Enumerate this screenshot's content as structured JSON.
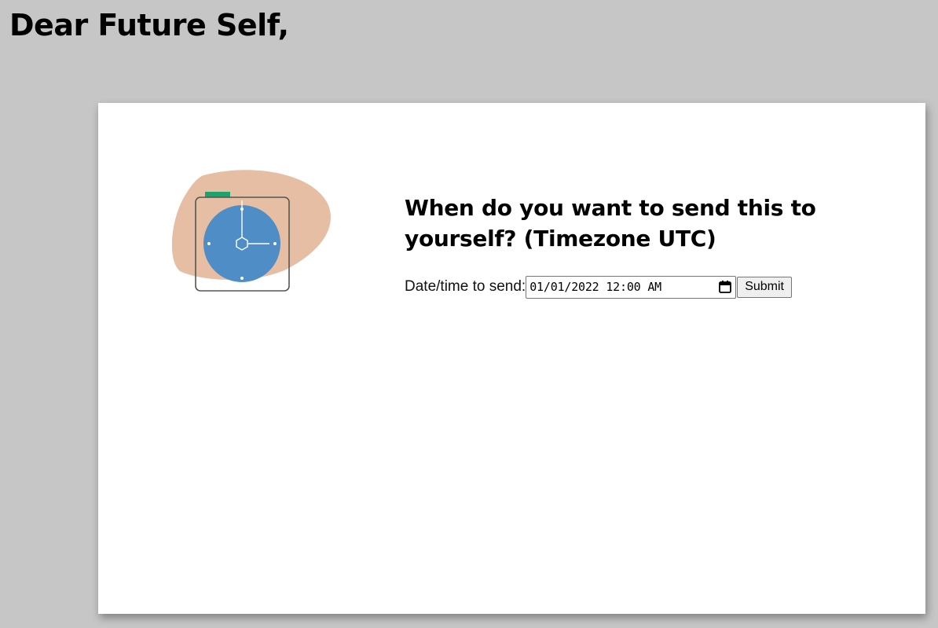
{
  "page": {
    "heading": "Dear Future Self,"
  },
  "card": {
    "question": "When do you want to send this to yourself? (Timezone UTC)",
    "form": {
      "label": "Date/time to send:",
      "datetime_value": "01/01/2022 12:00  AM",
      "submit_label": "Submit"
    }
  },
  "illustration": {
    "icon": "clock-icon",
    "colors": {
      "blob": "#e6bea3",
      "clock_face": "#4f8dc6",
      "clock_frame": "#555555",
      "tab": "#1aa36b"
    }
  },
  "colors": {
    "page_background": "#c6c6c6",
    "card_background": "#ffffff"
  }
}
